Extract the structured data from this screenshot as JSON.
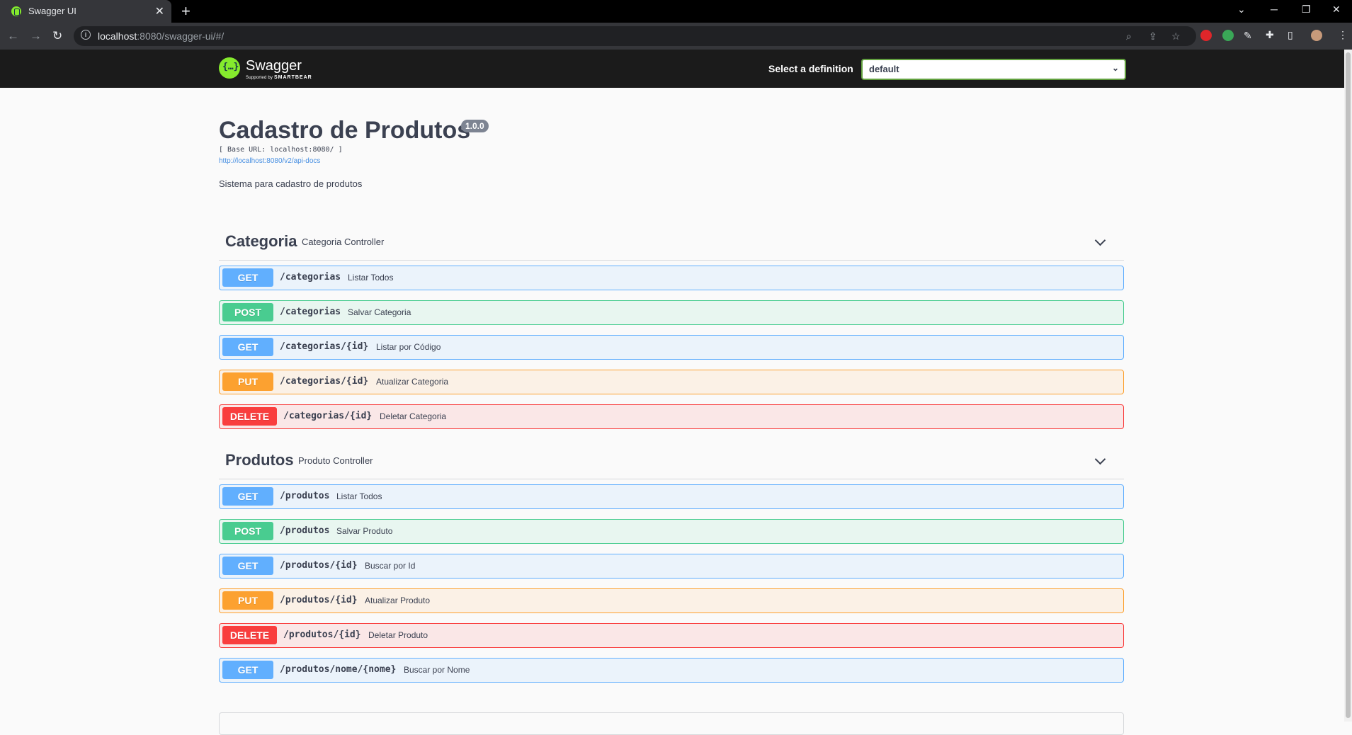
{
  "browser": {
    "tab_title": "Swagger UI",
    "url_host": "localhost",
    "url_rest": ":8080/swagger-ui/#/"
  },
  "topbar": {
    "logo_name": "Swagger",
    "logo_sub_prefix": "Supported by",
    "logo_sub_brand": "SMARTBEAR",
    "select_label": "Select a definition",
    "definition": "default"
  },
  "info": {
    "title": "Cadastro de Produtos",
    "version": "1.0.0",
    "base_url": "[ Base URL: localhost:8080/ ]",
    "api_docs_link": "http://localhost:8080/v2/api-docs",
    "description": "Sistema para cadastro de produtos"
  },
  "sections": [
    {
      "name": "Categoria",
      "description": "Categoria Controller",
      "operations": [
        {
          "method": "GET",
          "path": "/categorias",
          "summary": "Listar Todos"
        },
        {
          "method": "POST",
          "path": "/categorias",
          "summary": "Salvar Categoria"
        },
        {
          "method": "GET",
          "path": "/categorias/{id}",
          "summary": "Listar por Código"
        },
        {
          "method": "PUT",
          "path": "/categorias/{id}",
          "summary": "Atualizar Categoria"
        },
        {
          "method": "DELETE",
          "path": "/categorias/{id}",
          "summary": "Deletar Categoria"
        }
      ]
    },
    {
      "name": "Produtos",
      "description": "Produto Controller",
      "operations": [
        {
          "method": "GET",
          "path": "/produtos",
          "summary": "Listar Todos"
        },
        {
          "method": "POST",
          "path": "/produtos",
          "summary": "Salvar Produto"
        },
        {
          "method": "GET",
          "path": "/produtos/{id}",
          "summary": "Buscar por Id"
        },
        {
          "method": "PUT",
          "path": "/produtos/{id}",
          "summary": "Atualizar Produto"
        },
        {
          "method": "DELETE",
          "path": "/produtos/{id}",
          "summary": "Deletar Produto"
        },
        {
          "method": "GET",
          "path": "/produtos/nome/{nome}",
          "summary": "Buscar por Nome"
        }
      ]
    }
  ],
  "colors": {
    "get": "#61affe",
    "post": "#49cc90",
    "put": "#fca130",
    "delete": "#f93e3e",
    "swagger_green": "#85ea2d"
  }
}
